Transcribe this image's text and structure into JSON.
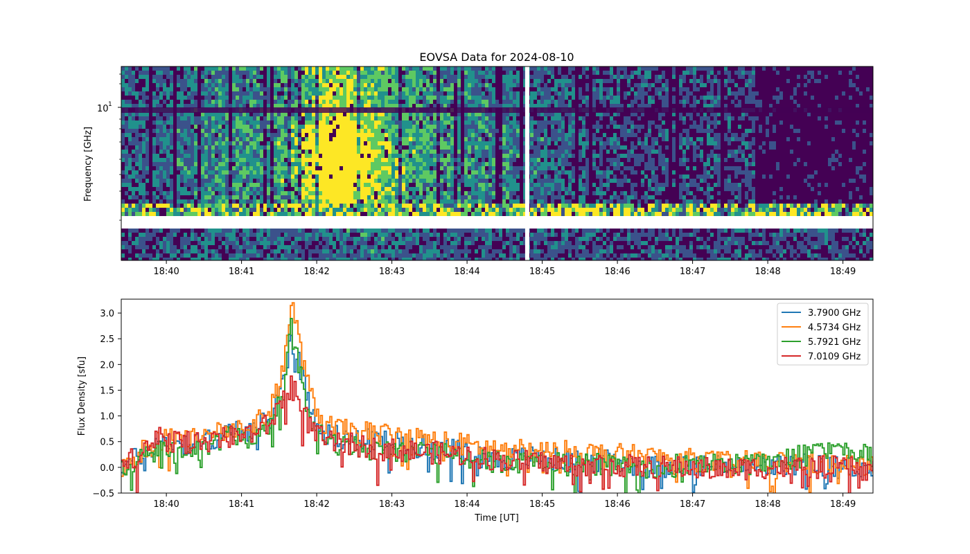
{
  "figure": {
    "title": "EOVSA Data for 2024-08-10"
  },
  "chart_data": [
    {
      "type": "heatmap",
      "title": "EOVSA Data for 2024-08-10",
      "xlabel": "",
      "ylabel": "Frequency [GHz]",
      "y_scale": "log",
      "y_major_tick_base": "10",
      "y_major_tick_exponent": "1",
      "x_ticks": [
        "18:40",
        "18:41",
        "18:42",
        "18:43",
        "18:44",
        "18:45",
        "18:46",
        "18:47",
        "18:48",
        "18:49"
      ],
      "colormap": [
        "#440154",
        "#3b528b",
        "#21918c",
        "#5ec962",
        "#fde725"
      ],
      "data_gaps": [
        {
          "kind": "time",
          "at": "18:44:48"
        },
        {
          "kind": "frequency",
          "label": "band gap between lower and upper bands"
        }
      ],
      "intensity_peak_time": "18:42:15",
      "grid": false
    },
    {
      "type": "line",
      "xlabel": "Time [UT]",
      "ylabel": "Flux Density [sfu]",
      "x_ticks": [
        "18:40",
        "18:41",
        "18:42",
        "18:43",
        "18:44",
        "18:45",
        "18:46",
        "18:47",
        "18:48",
        "18:49"
      ],
      "x_range_minutes": [
        0,
        10
      ],
      "y_ticks": [
        "−0.5",
        "0.0",
        "0.5",
        "1.0",
        "1.5",
        "2.0",
        "2.5",
        "3.0"
      ],
      "ylim": [
        -0.5,
        3.27
      ],
      "legend_position": "top-right",
      "grid": false,
      "series": [
        {
          "name": "3.7900 GHz",
          "color": "#1f77b4",
          "x": [
            0,
            0.5,
            1,
            1.5,
            1.8,
            2.0,
            2.15,
            2.25,
            2.35,
            2.5,
            2.7,
            3.0,
            3.5,
            4.0,
            4.5,
            5.0,
            5.5,
            6.0,
            6.5,
            7.0,
            7.5,
            8.0,
            8.5,
            9.0,
            9.5,
            10.0
          ],
          "y": [
            0.0,
            0.5,
            0.45,
            0.7,
            0.75,
            1.0,
            1.75,
            2.55,
            2.05,
            1.2,
            0.65,
            0.55,
            0.5,
            0.4,
            0.3,
            0.15,
            0.2,
            0.1,
            0.15,
            0.0,
            0.05,
            0.0,
            0.0,
            0.05,
            0.0,
            0.0
          ]
        },
        {
          "name": "4.5734 GHz",
          "color": "#ff7f0e",
          "x": [
            0,
            0.5,
            1,
            1.5,
            1.8,
            2.0,
            2.15,
            2.25,
            2.35,
            2.5,
            2.7,
            3.0,
            3.5,
            4.0,
            4.5,
            5.0,
            5.5,
            6.0,
            6.5,
            7.0,
            7.5,
            8.0,
            8.5,
            9.0,
            9.5,
            10.0
          ],
          "y": [
            0.0,
            0.55,
            0.55,
            0.75,
            0.85,
            1.2,
            2.0,
            3.2,
            2.5,
            1.4,
            0.8,
            0.7,
            0.65,
            0.55,
            0.45,
            0.35,
            0.3,
            0.3,
            0.25,
            0.2,
            0.15,
            0.1,
            0.1,
            0.1,
            0.05,
            0.0
          ]
        },
        {
          "name": "5.7921 GHz",
          "color": "#2ca02c",
          "x": [
            0,
            0.5,
            1,
            1.5,
            1.8,
            2.0,
            2.15,
            2.25,
            2.35,
            2.5,
            2.7,
            3.0,
            3.5,
            4.0,
            4.5,
            5.0,
            5.5,
            6.0,
            6.5,
            7.0,
            7.5,
            8.0,
            8.5,
            9.0,
            9.5,
            10.0
          ],
          "y": [
            -0.1,
            0.4,
            0.35,
            0.6,
            0.6,
            0.9,
            1.5,
            2.7,
            1.9,
            1.0,
            0.5,
            0.4,
            0.35,
            0.3,
            0.2,
            0.1,
            0.1,
            0.05,
            0.05,
            0.0,
            0.05,
            0.05,
            0.1,
            0.2,
            0.3,
            0.2
          ]
        },
        {
          "name": "7.0109 GHz",
          "color": "#d62728",
          "x": [
            0,
            0.5,
            1,
            1.5,
            1.8,
            2.0,
            2.15,
            2.25,
            2.35,
            2.5,
            2.7,
            3.0,
            3.5,
            4.0,
            4.5,
            5.0,
            5.5,
            6.0,
            6.5,
            7.0,
            7.5,
            8.0,
            8.5,
            9.0,
            9.5,
            10.0
          ],
          "y": [
            0.0,
            0.55,
            0.45,
            0.6,
            0.7,
            0.9,
            1.4,
            1.8,
            1.3,
            0.8,
            0.5,
            0.45,
            0.35,
            0.3,
            0.25,
            0.15,
            0.1,
            0.05,
            0.05,
            0.0,
            0.0,
            -0.05,
            0.0,
            0.0,
            0.0,
            -0.05
          ]
        }
      ]
    }
  ]
}
